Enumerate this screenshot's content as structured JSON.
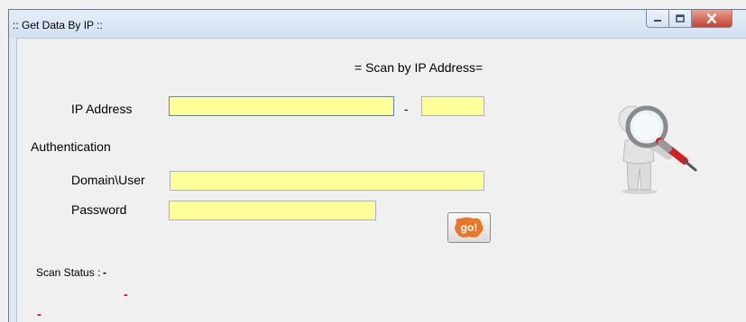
{
  "window": {
    "title": ":: Get Data By IP ::"
  },
  "form": {
    "heading": "= Scan by IP Address=",
    "ip_label": "IP Address",
    "ip_separator": "-",
    "ip_start_value": "",
    "ip_end_value": "",
    "auth_label": "Authentication",
    "domain_user_label": "Domain\\User",
    "domain_user_value": "",
    "password_label": "Password",
    "password_value": "",
    "go_label": "go!"
  },
  "status": {
    "label": "Scan Status :",
    "value": "-",
    "line2": "-",
    "line3": "-"
  },
  "colors": {
    "field_bg": "#ffff99",
    "go_orange": "#e8762b",
    "error_red": "#e00000"
  },
  "icons": [
    "minimize-icon",
    "maximize-icon",
    "close-icon",
    "magnifier-person-icon"
  ]
}
